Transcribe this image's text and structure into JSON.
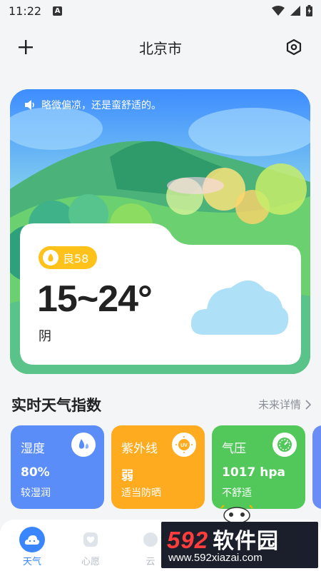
{
  "status_bar": {
    "time": "11:22",
    "notice_badge": "A"
  },
  "header": {
    "city": "北京市",
    "add_icon": "plus-icon",
    "settings_icon": "hexagon-settings-icon"
  },
  "hero": {
    "tip": "略微偏凉，还是蛮舒适的。",
    "aqi": "良58",
    "temperature": "15~24°",
    "condition": "阴"
  },
  "indices": {
    "title": "实时天气指数",
    "more": "未来详情",
    "cards": [
      {
        "name": "湿度",
        "value": "80%",
        "desc": "较湿润",
        "color": "#5b8df8",
        "icon": "water-drops-icon"
      },
      {
        "name": "紫外线",
        "value": "弱",
        "desc": "适当防晒",
        "color": "#ffab1f",
        "icon": "uv-sun-icon"
      },
      {
        "name": "气压",
        "value": "1017 hpa",
        "desc": "不舒适",
        "color": "#52c85a",
        "icon": "gauge-icon"
      }
    ]
  },
  "nav": {
    "items": [
      {
        "label": "天气",
        "active": true
      },
      {
        "label": "心愿",
        "active": false
      },
      {
        "label": "云",
        "active": false
      }
    ]
  },
  "watermark": {
    "number": "592",
    "name": "软件园",
    "url": "www.592xiazai.com"
  },
  "colors": {
    "accent": "#3a86ff",
    "aqi": "#ffc21a",
    "text": "#222222"
  }
}
